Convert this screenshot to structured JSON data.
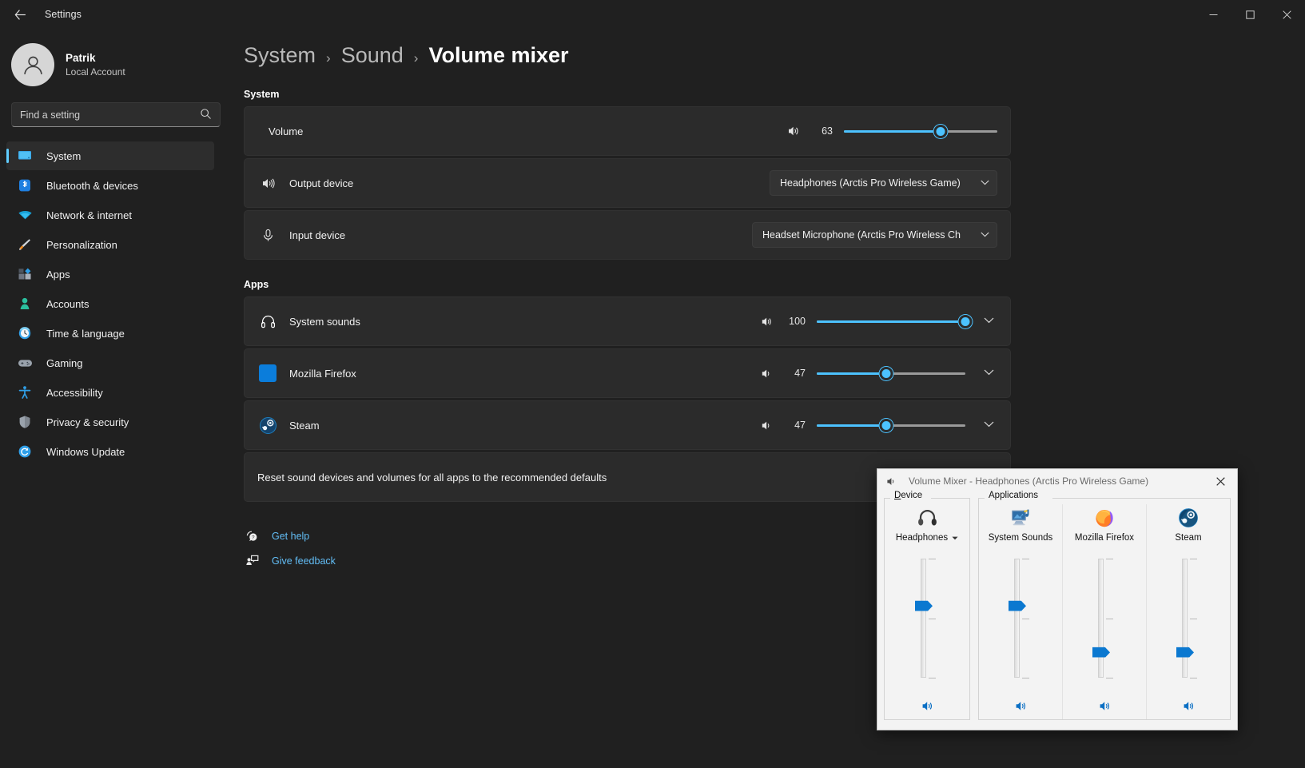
{
  "titlebar": {
    "back_icon": "back-arrow-icon",
    "title": "Settings",
    "minimize_label": "—",
    "maximize_label": "□",
    "close_label": "✕"
  },
  "sidebar": {
    "profile": {
      "name": "Patrik",
      "account_type": "Local Account",
      "avatar_icon": "user-avatar-icon"
    },
    "search": {
      "placeholder": "Find a setting",
      "value": "",
      "icon": "search-icon"
    },
    "items": [
      {
        "label": "System",
        "icon": "monitor-icon",
        "active": true
      },
      {
        "label": "Bluetooth & devices",
        "icon": "bluetooth-icon",
        "active": false
      },
      {
        "label": "Network & internet",
        "icon": "wifi-icon",
        "active": false
      },
      {
        "label": "Personalization",
        "icon": "paintbrush-icon",
        "active": false
      },
      {
        "label": "Apps",
        "icon": "apps-grid-icon",
        "active": false
      },
      {
        "label": "Accounts",
        "icon": "person-icon",
        "active": false
      },
      {
        "label": "Time & language",
        "icon": "clock-icon",
        "active": false
      },
      {
        "label": "Gaming",
        "icon": "gamepad-icon",
        "active": false
      },
      {
        "label": "Accessibility",
        "icon": "accessibility-icon",
        "active": false
      },
      {
        "label": "Privacy & security",
        "icon": "shield-icon",
        "active": false
      },
      {
        "label": "Windows Update",
        "icon": "update-refresh-icon",
        "active": false
      }
    ]
  },
  "main": {
    "breadcrumb": [
      {
        "label": "System",
        "current": false
      },
      {
        "label": "Sound",
        "current": false
      },
      {
        "label": "Volume mixer",
        "current": true
      }
    ],
    "breadcrumb_separator": "›",
    "system_section": {
      "title": "System",
      "volume_row": {
        "label": "Volume",
        "speaker_icon": "speaker-icon",
        "value": 63,
        "value_text": "63",
        "min": 0,
        "max": 100
      },
      "output_row": {
        "label": "Output device",
        "icon": "speaker-waves-icon",
        "selected": "Headphones (Arctis Pro Wireless Game)",
        "chevron": "˅"
      },
      "input_row": {
        "label": "Input device",
        "icon": "microphone-icon",
        "selected": "Headset Microphone (Arctis Pro Wireless Ch",
        "chevron": "˅"
      }
    },
    "apps_section": {
      "title": "Apps",
      "rows": [
        {
          "label": "System sounds",
          "icon": "headphones-icon",
          "icon_color": "#ffffff",
          "speaker_icon": "speaker-icon",
          "value": 100,
          "value_text": "100",
          "expand_chevron": "˅"
        },
        {
          "label": "Mozilla Firefox",
          "icon": "firefox-square-icon",
          "icon_color": "#0b7ddb",
          "speaker_icon": "speaker-icon",
          "value": 47,
          "value_text": "47",
          "expand_chevron": "˅"
        },
        {
          "label": "Steam",
          "icon": "steam-icon",
          "icon_color": "#1b8fd6",
          "speaker_icon": "speaker-icon",
          "value": 47,
          "value_text": "47",
          "expand_chevron": "˅"
        }
      ]
    },
    "reset_row": {
      "text": "Reset sound devices and volumes for all apps to the recommended defaults"
    },
    "links": [
      {
        "label": "Get help",
        "icon": "help-question-icon"
      },
      {
        "label": "Give feedback",
        "icon": "feedback-icon"
      }
    ]
  },
  "volume_mixer_dialog": {
    "title": "Volume Mixer - Headphones (Arctis Pro Wireless Game)",
    "title_icon": "speaker-small-icon",
    "close_label": "✕",
    "device_group_label": "Device",
    "applications_group_label": "Applications",
    "device_channel": {
      "name": "Headphones",
      "icon": "headphones-photo-icon",
      "has_dropdown": true,
      "caret": "▾",
      "level": 63,
      "mute_icon": "speaker-blue-icon"
    },
    "app_channels": [
      {
        "name": "System Sounds",
        "icon": "system-sounds-icon",
        "level": 63,
        "mute_icon": "speaker-blue-icon"
      },
      {
        "name": "Mozilla Firefox",
        "icon": "firefox-icon",
        "level": 29,
        "mute_icon": "speaker-blue-icon"
      },
      {
        "name": "Steam",
        "icon": "steam-round-icon",
        "level": 29,
        "mute_icon": "speaker-blue-icon"
      }
    ]
  },
  "colors": {
    "accent": "#4cc2ff",
    "window_bg": "#202020",
    "card_bg": "#2b2b2b",
    "link": "#62bdf5",
    "dialog_bg": "#f3f3f3",
    "dialog_thumb": "#0b78d0"
  }
}
